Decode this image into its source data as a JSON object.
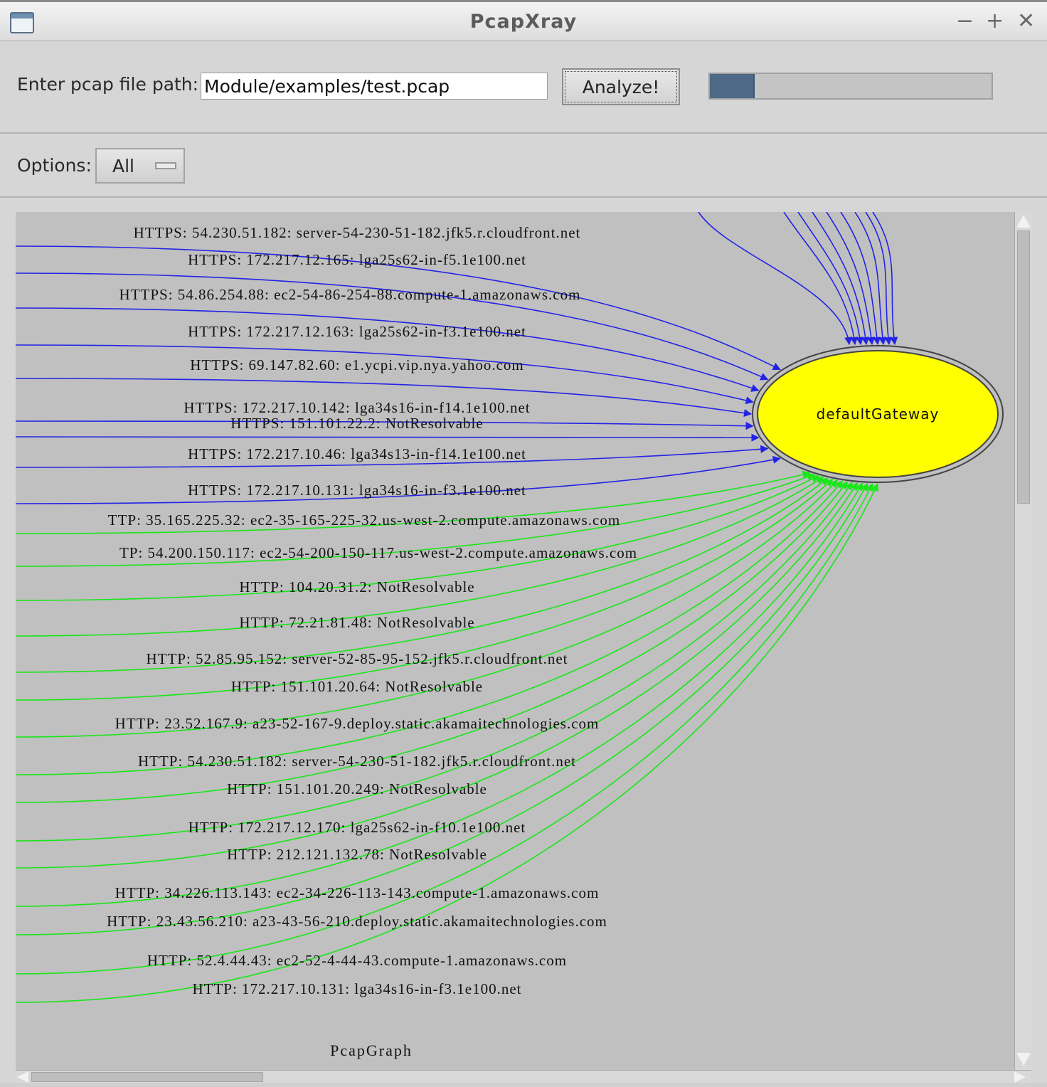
{
  "window": {
    "title": "PcapXray",
    "minimize_glyph": "−",
    "maximize_glyph": "+",
    "close_glyph": "✕"
  },
  "form": {
    "path_label": "Enter pcap file path:",
    "path_value": "Module/examples/test.pcap",
    "analyze_label": "Analyze!",
    "progress": 0.16
  },
  "options": {
    "label": "Options:",
    "selected": "All"
  },
  "graph": {
    "node_label": "defaultGateway",
    "graph_label": "PcapGraph",
    "colors": {
      "https_edge": "#2323e6",
      "http_edge": "#19e619",
      "node_fill": "#ffff00",
      "background": "#c0c0c0"
    },
    "https_edges": [
      "HTTPS: 54.230.51.182: server-54-230-51-182.jfk5.r.cloudfront.net",
      "HTTPS: 172.217.12.165: lga25s62-in-f5.1e100.net",
      "HTTPS: 54.86.254.88: ec2-54-86-254-88.compute-1.amazonaws.com",
      "HTTPS: 172.217.12.163: lga25s62-in-f3.1e100.net",
      "HTTPS: 69.147.82.60: e1.ycpi.vip.nya.yahoo.com",
      "HTTPS: 172.217.10.142: lga34s16-in-f14.1e100.net",
      "HTTPS: 151.101.22.2: NotResolvable",
      "HTTPS: 172.217.10.46: lga34s13-in-f14.1e100.net",
      "HTTPS: 172.217.10.131: lga34s16-in-f3.1e100.net"
    ],
    "http_edges": [
      "TTP: 35.165.225.32: ec2-35-165-225-32.us-west-2.compute.amazonaws.com",
      "TP: 54.200.150.117: ec2-54-200-150-117.us-west-2.compute.amazonaws.com",
      "HTTP: 104.20.31.2: NotResolvable",
      "HTTP: 72.21.81.48: NotResolvable",
      "HTTP: 52.85.95.152: server-52-85-95-152.jfk5.r.cloudfront.net",
      "HTTP: 151.101.20.64: NotResolvable",
      "HTTP: 23.52.167.9: a23-52-167-9.deploy.static.akamaitechnologies.com",
      "HTTP: 54.230.51.182: server-54-230-51-182.jfk5.r.cloudfront.net",
      "HTTP: 151.101.20.249: NotResolvable",
      "HTTP: 172.217.12.170: lga25s62-in-f10.1e100.net",
      "HTTP: 212.121.132.78: NotResolvable",
      "HTTP: 34.226.113.143: ec2-34-226-113-143.compute-1.amazonaws.com",
      "HTTP: 23.43.56.210: a23-43-56-210.deploy.static.akamaitechnologies.com",
      "HTTP: 52.4.44.43: ec2-52-4-44-43.compute-1.amazonaws.com",
      "HTTP: 172.217.10.131: lga34s16-in-f3.1e100.net"
    ]
  }
}
